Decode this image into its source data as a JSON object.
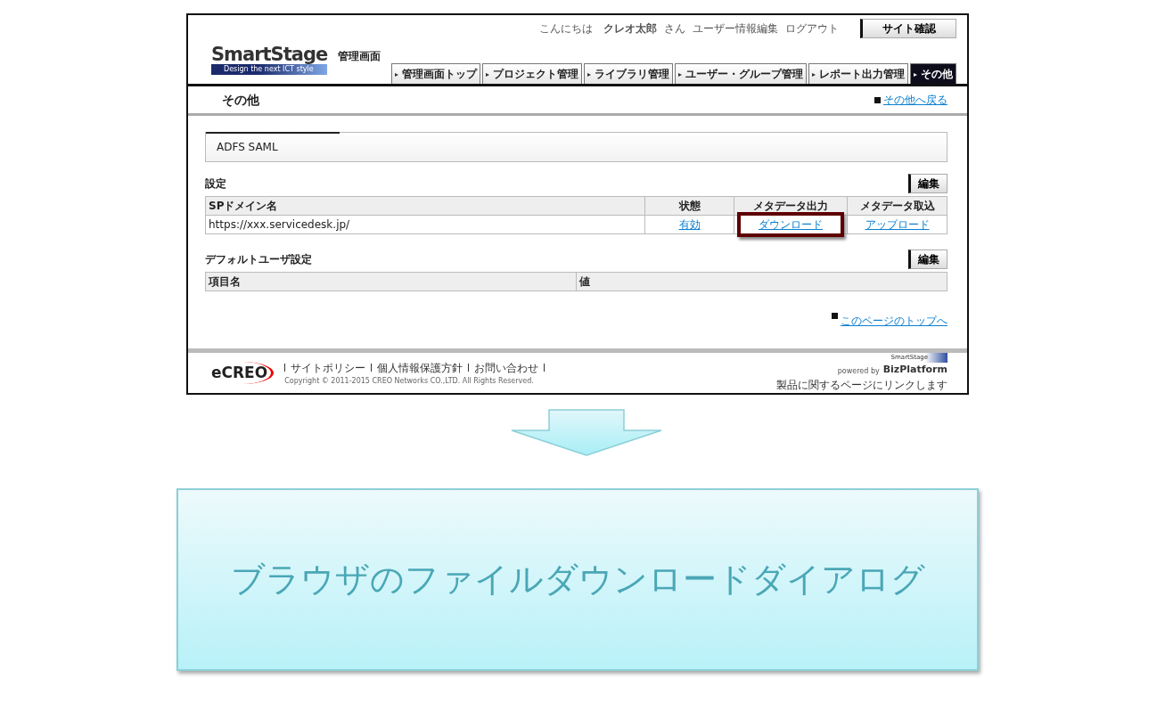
{
  "app": {
    "logo": "SmartStage",
    "logo_tagline": "Design the next ICT style",
    "area_label": "管理画面",
    "greeting": {
      "prefix": "こんにちは",
      "user": "クレオ太郎",
      "suffix": "さん"
    },
    "header_links": [
      "ユーザー情報編集",
      "ログアウト"
    ],
    "site_button": "サイト確認",
    "tabs": [
      {
        "label": "管理画面トップ",
        "selected": false
      },
      {
        "label": "プロジェクト管理",
        "selected": false
      },
      {
        "label": "ライブラリ管理",
        "selected": false
      },
      {
        "label": "ユーザー・グループ管理",
        "selected": false
      },
      {
        "label": "レポート出力管理",
        "selected": false
      },
      {
        "label": "その他",
        "selected": true
      }
    ],
    "page_title": "その他",
    "back_link": "その他へ戻る",
    "panel_title": "ADFS SAML",
    "sections": [
      {
        "title": "設定",
        "edit_button": "編集",
        "columns": [
          "SPドメイン名",
          "状態",
          "メタデータ出力",
          "メタデータ取込"
        ],
        "rows": [
          [
            {
              "text": "https://xxx.servicedesk.jp/",
              "link": false,
              "highlighted": false
            },
            {
              "text": "有効",
              "link": true,
              "highlighted": false
            },
            {
              "text": "ダウンロード",
              "link": true,
              "highlighted": true
            },
            {
              "text": "アップロード",
              "link": true,
              "highlighted": false
            }
          ]
        ]
      },
      {
        "title": "デフォルトユーザ設定",
        "edit_button": "編集",
        "columns": [
          "項目名",
          "値"
        ]
      }
    ],
    "top_link": "このページのトップへ",
    "footer": {
      "logo": "eCREO",
      "links": [
        "サイトポリシー",
        "個人情報保護方針",
        "お問い合わせ"
      ],
      "copyright": "Copyright © 2011-2015 CREO Networks CO.,LTD. All Rights Reserved.",
      "powered_by": "powered by",
      "badge_small": "SmartStage",
      "badge_name": "BizPlatform",
      "product_note": "製品に関するページにリンクします"
    }
  },
  "callout": {
    "text": "ブラウザのファイルダウンロードダイアログ"
  }
}
